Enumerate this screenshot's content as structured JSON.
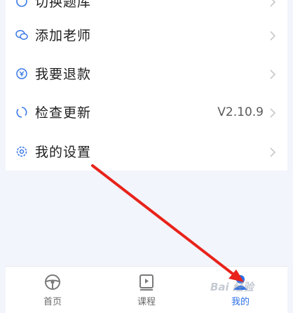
{
  "menu": {
    "partial_top_label": "切换题库",
    "items": [
      {
        "label": "添加老师",
        "value": ""
      },
      {
        "label": "我要退款",
        "value": ""
      },
      {
        "label": "检查更新",
        "value": "V2.10.9"
      },
      {
        "label": "我的设置",
        "value": ""
      }
    ]
  },
  "tabbar": {
    "tabs": [
      {
        "label": "首页",
        "icon": "steering-wheel-icon",
        "active": false
      },
      {
        "label": "课程",
        "icon": "course-play-icon",
        "active": false
      },
      {
        "label": "我的",
        "icon": "profile-icon",
        "active": true
      }
    ]
  },
  "watermark": "Bai 经验",
  "colors": {
    "accent": "#2b6fe8",
    "arrow": "#e8231b",
    "background": "#f2f5fb"
  }
}
